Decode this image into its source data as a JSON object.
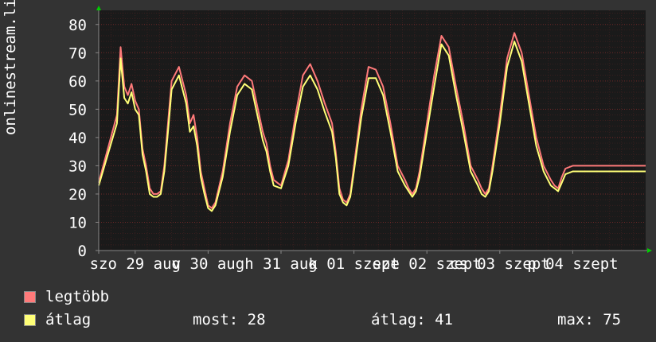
{
  "colors": {
    "max": "#ff7a7a",
    "avg": "#ffff77",
    "plot_bg": "#1a1a1a",
    "page_bg": "#333333",
    "grid": "#7a2a2a",
    "axis": "#888888"
  },
  "chart_data": {
    "type": "line",
    "ylabel": "onlinestream.live",
    "ylim": [
      0,
      85
    ],
    "yticks": [
      "0",
      "10",
      "20",
      "30",
      "40",
      "50",
      "60",
      "70",
      "80"
    ],
    "xticks": [
      "szo 29 aug",
      "v 30 aug",
      "h 31 aug",
      "k 01 szept",
      "sze 02 szept",
      "cs 03 szept",
      "p 04 szept"
    ],
    "grid": true,
    "x_range_days": [
      0,
      7.5
    ],
    "series": [
      {
        "name": "legtöbb",
        "color": "#ff7a7a",
        "x": [
          0.0,
          0.25,
          0.3,
          0.35,
          0.4,
          0.45,
          0.5,
          0.55,
          0.6,
          0.65,
          0.7,
          0.75,
          0.8,
          0.85,
          0.9,
          0.95,
          1.0,
          1.1,
          1.2,
          1.25,
          1.3,
          1.35,
          1.4,
          1.45,
          1.5,
          1.55,
          1.6,
          1.7,
          1.8,
          1.9,
          2.0,
          2.1,
          2.2,
          2.25,
          2.3,
          2.35,
          2.4,
          2.5,
          2.6,
          2.7,
          2.8,
          2.9,
          3.0,
          3.1,
          3.2,
          3.25,
          3.3,
          3.35,
          3.4,
          3.45,
          3.5,
          3.6,
          3.7,
          3.8,
          3.9,
          4.0,
          4.1,
          4.2,
          4.25,
          4.3,
          4.35,
          4.4,
          4.5,
          4.6,
          4.7,
          4.8,
          4.9,
          5.0,
          5.1,
          5.2,
          5.25,
          5.3,
          5.35,
          5.4,
          5.5,
          5.6,
          5.7,
          5.8,
          5.9,
          6.0,
          6.1,
          6.2,
          6.25,
          6.3,
          6.35,
          6.4,
          6.5,
          6.6,
          6.7,
          6.8,
          6.9,
          7.0,
          7.1,
          7.2,
          7.25,
          7.3,
          7.35,
          7.4,
          7.5
        ],
        "values": [
          24,
          48,
          72,
          58,
          55,
          59,
          53,
          50,
          36,
          30,
          22,
          20,
          20,
          21,
          30,
          45,
          60,
          65,
          55,
          45,
          48,
          40,
          28,
          22,
          16,
          15,
          17,
          28,
          45,
          58,
          62,
          60,
          48,
          42,
          38,
          30,
          25,
          23,
          32,
          48,
          62,
          66,
          60,
          52,
          45,
          35,
          22,
          18,
          17,
          20,
          30,
          50,
          65,
          64,
          58,
          45,
          30,
          25,
          22,
          20,
          22,
          28,
          45,
          62,
          76,
          72,
          58,
          45,
          30,
          25,
          22,
          20,
          22,
          30,
          48,
          68,
          77,
          70,
          55,
          40,
          30,
          25,
          23,
          22,
          26,
          29,
          30,
          30,
          30,
          30,
          30,
          30,
          30,
          30,
          30,
          30,
          30,
          30,
          30
        ]
      },
      {
        "name": "átlag",
        "color": "#ffff77",
        "x": [
          0.0,
          0.25,
          0.3,
          0.35,
          0.4,
          0.45,
          0.5,
          0.55,
          0.6,
          0.65,
          0.7,
          0.75,
          0.8,
          0.85,
          0.9,
          0.95,
          1.0,
          1.1,
          1.2,
          1.25,
          1.3,
          1.35,
          1.4,
          1.45,
          1.5,
          1.55,
          1.6,
          1.7,
          1.8,
          1.9,
          2.0,
          2.1,
          2.2,
          2.25,
          2.3,
          2.35,
          2.4,
          2.5,
          2.6,
          2.7,
          2.8,
          2.9,
          3.0,
          3.1,
          3.2,
          3.25,
          3.3,
          3.35,
          3.4,
          3.45,
          3.5,
          3.6,
          3.7,
          3.8,
          3.9,
          4.0,
          4.1,
          4.2,
          4.25,
          4.3,
          4.35,
          4.4,
          4.5,
          4.6,
          4.7,
          4.8,
          4.9,
          5.0,
          5.1,
          5.2,
          5.25,
          5.3,
          5.35,
          5.4,
          5.5,
          5.6,
          5.7,
          5.8,
          5.9,
          6.0,
          6.1,
          6.2,
          6.25,
          6.3,
          6.35,
          6.4,
          6.5,
          6.6,
          6.7,
          6.8,
          6.9,
          7.0,
          7.1,
          7.2,
          7.25,
          7.3,
          7.35,
          7.4,
          7.5
        ],
        "values": [
          23,
          45,
          68,
          54,
          52,
          56,
          50,
          48,
          34,
          28,
          20,
          19,
          19,
          20,
          28,
          42,
          57,
          62,
          52,
          42,
          44,
          37,
          26,
          20,
          15,
          14,
          16,
          26,
          42,
          55,
          59,
          57,
          45,
          39,
          35,
          28,
          23,
          22,
          30,
          45,
          58,
          62,
          57,
          49,
          42,
          33,
          20,
          17,
          16,
          19,
          28,
          47,
          61,
          61,
          55,
          42,
          28,
          23,
          21,
          19,
          21,
          26,
          42,
          58,
          73,
          69,
          55,
          42,
          28,
          23,
          20,
          19,
          21,
          28,
          45,
          65,
          74,
          67,
          52,
          37,
          28,
          23,
          22,
          21,
          24,
          27,
          28,
          28,
          28,
          28,
          28,
          28,
          28,
          28,
          28,
          28,
          28,
          28,
          28
        ]
      }
    ]
  },
  "legend": [
    {
      "label": "legtöbb",
      "color": "#ff7a7a"
    },
    {
      "label": "átlag",
      "color": "#ffff77"
    }
  ],
  "stats": {
    "most": "most: 28",
    "atlag": "átlag: 41",
    "max": "max: 75"
  }
}
